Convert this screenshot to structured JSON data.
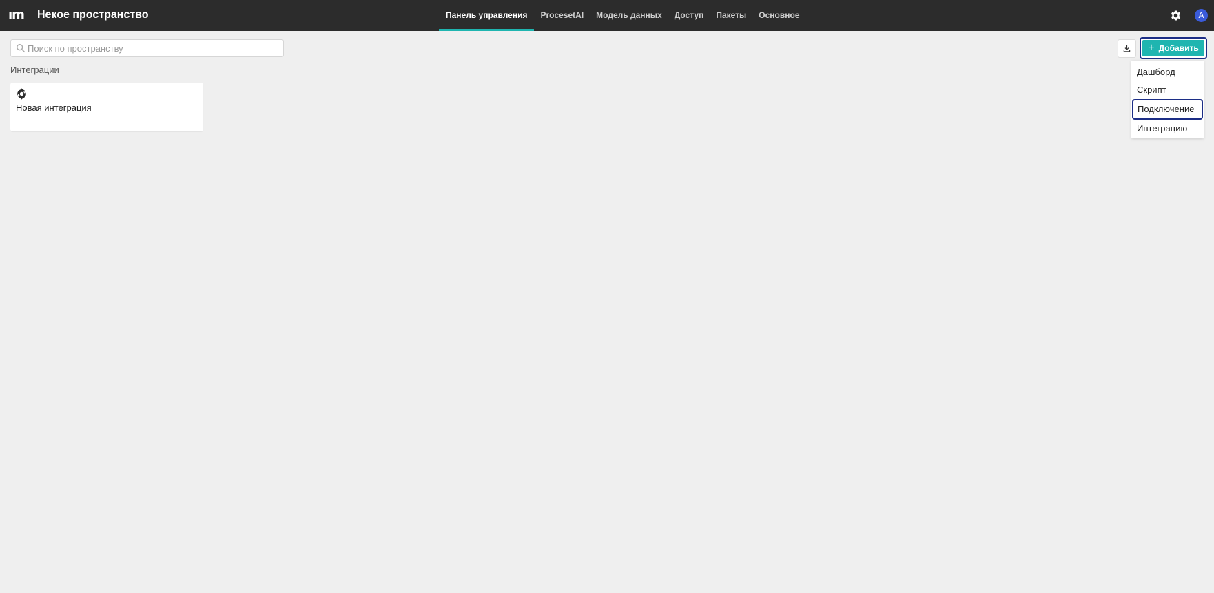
{
  "header": {
    "logo": "ım",
    "space_title": "Некое пространство",
    "tabs": [
      {
        "label": "Панель управления",
        "active": true
      },
      {
        "label": "ProcesetAI",
        "active": false
      },
      {
        "label": "Модель данных",
        "active": false
      },
      {
        "label": "Доступ",
        "active": false
      },
      {
        "label": "Пакеты",
        "active": false
      },
      {
        "label": "Основное",
        "active": false
      }
    ],
    "user_initial": "A",
    "settings_icon": "gear-icon"
  },
  "search": {
    "placeholder": "Поиск по пространству",
    "value": ""
  },
  "section": {
    "label": "Интеграции",
    "cards": [
      {
        "title": "Новая интеграция",
        "icon": "integration-icon"
      }
    ]
  },
  "toolbar": {
    "download_icon": "download-icon",
    "add_label": "Добавить"
  },
  "add_menu": {
    "items": [
      "Дашборд",
      "Скрипт",
      "Подключение",
      "Интеграцию"
    ],
    "focused_index": 2
  },
  "colors": {
    "topbar": "#2c2c2c",
    "accent": "#1fb5b0",
    "focus_ring": "#1c2e86",
    "avatar": "#3a5bd9",
    "background": "#efefef"
  }
}
